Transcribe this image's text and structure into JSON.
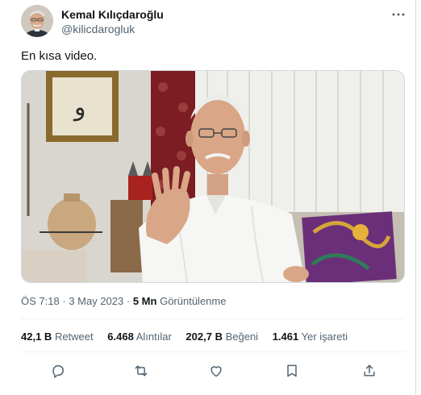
{
  "author": {
    "display_name": "Kemal Kılıçdaroğlu",
    "handle": "@kilicdarogluk"
  },
  "tweet": {
    "text": "En kısa video."
  },
  "meta": {
    "time": "ÖS 7:18",
    "separator": "·",
    "date": "3 May 2023",
    "views_count": "5 Mn",
    "views_label": "Görüntülenme"
  },
  "stats": [
    {
      "count": "42,1 B",
      "label": "Retweet"
    },
    {
      "count": "6.468",
      "label": "Alıntılar"
    },
    {
      "count": "202,7 B",
      "label": "Beğeni"
    },
    {
      "count": "1.461",
      "label": "Yer işareti"
    }
  ],
  "actions": [
    "reply-icon",
    "retweet-icon",
    "like-icon",
    "bookmark-icon",
    "share-icon"
  ],
  "colors": {
    "text_primary": "#0f1419",
    "text_secondary": "#536471",
    "border": "#cfd9de"
  }
}
